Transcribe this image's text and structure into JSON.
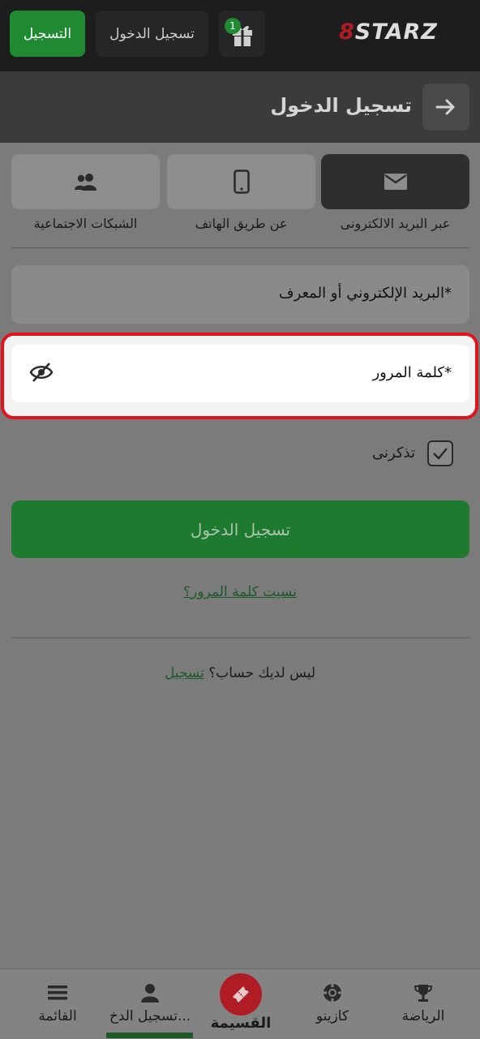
{
  "header": {
    "logo_mark": "8",
    "logo_text": "STARZ",
    "register_label": "التسجيل",
    "login_label": "تسجيل الدخول",
    "gift_badge": "1"
  },
  "subheader": {
    "title": "تسجيل الدخول"
  },
  "tabs": [
    {
      "label": "عبر البريد الالكترونى",
      "icon": "envelope-icon",
      "active": true
    },
    {
      "label": "عن طريق الهاتف",
      "icon": "phone-icon",
      "active": false
    },
    {
      "label": "الشبكات الاجتماعية",
      "icon": "users-icon",
      "active": false
    }
  ],
  "form": {
    "email_label": "البريد الإلكتروني أو المعرف*",
    "password_label": "كلمة المرور*",
    "remember_label": "تذكرنى",
    "remember_checked": true,
    "submit_label": "تسجيل الدخول",
    "forgot_label": "نسيت كلمة المرور؟",
    "no_account_text": "ليس لديك حساب؟",
    "register_link": "تسجيل"
  },
  "bottom_nav": [
    {
      "label": "الرياضة",
      "icon": "trophy-icon"
    },
    {
      "label": "كازينو",
      "icon": "casino-chip-icon"
    },
    {
      "label": "القسيمة",
      "icon": "ticket-icon"
    },
    {
      "label": "تسجيل الدخ...",
      "icon": "user-icon"
    },
    {
      "label": "القائمة",
      "icon": "menu-icon"
    }
  ],
  "colors": {
    "accent_green": "#1f8a32",
    "brand_red": "#b01c24",
    "highlight_red": "#e0141e"
  }
}
